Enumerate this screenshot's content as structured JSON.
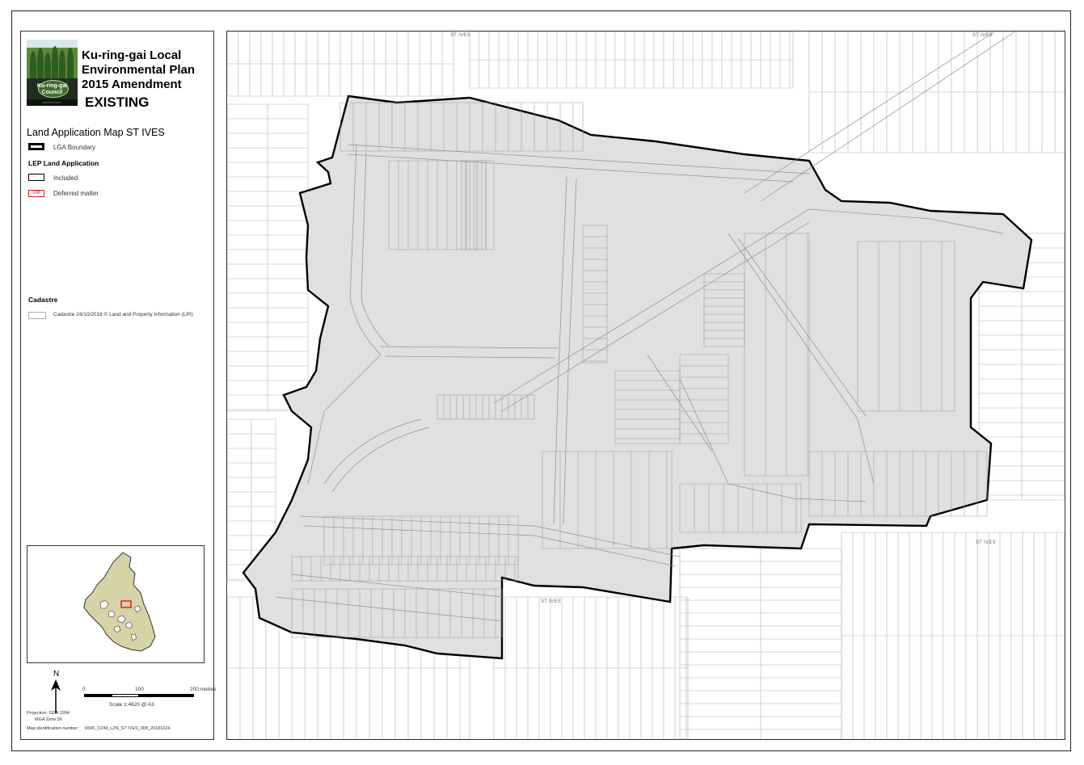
{
  "logo": {
    "text_line1": "Ku-ring-gai",
    "text_line2": "Council"
  },
  "title": {
    "line1": "Ku-ring-gai Local",
    "line2": "Environmental Plan",
    "line3": "2015 Amendment",
    "status": "EXISTING"
  },
  "legend": {
    "map_title": "Land Application Map ST IVES",
    "lga_boundary_label": "LGA Boundary",
    "lep_section_title": "LEP Land Application",
    "included_label": "Included",
    "deferred_swatch_text": "DM",
    "deferred_label": "Deferred matter",
    "cadastre_section_title": "Cadastre",
    "cadastre_label": "Cadastre 24/10/2018 © Land and Property Information (LPI)"
  },
  "north": {
    "letter": "N"
  },
  "scale_bar": {
    "tick_0": "0",
    "tick_100": "100",
    "tick_200": "200 metres",
    "scale_text": "Scale   1:4620   @ A3"
  },
  "projection": {
    "line1": "Projection: GDA 1994",
    "line2": "MGA Zone 56"
  },
  "map_id": {
    "label": "Map identification number:",
    "value": "6500_COM_LZN_ST IVES_008_20181024"
  },
  "map_labels": {
    "suburb_top_left": "ST IVES",
    "suburb_top_right": "ST IVES",
    "suburb_bottom_mid": "ST IVES",
    "suburb_bottom_right": "ST IVES"
  },
  "colors": {
    "included_fill": "#dfe1de",
    "boundary": "#000000",
    "deferred": "#e31a1c",
    "cadastre_line": "#a8a8a8",
    "inset_lga_fill": "#d6d3a6"
  }
}
